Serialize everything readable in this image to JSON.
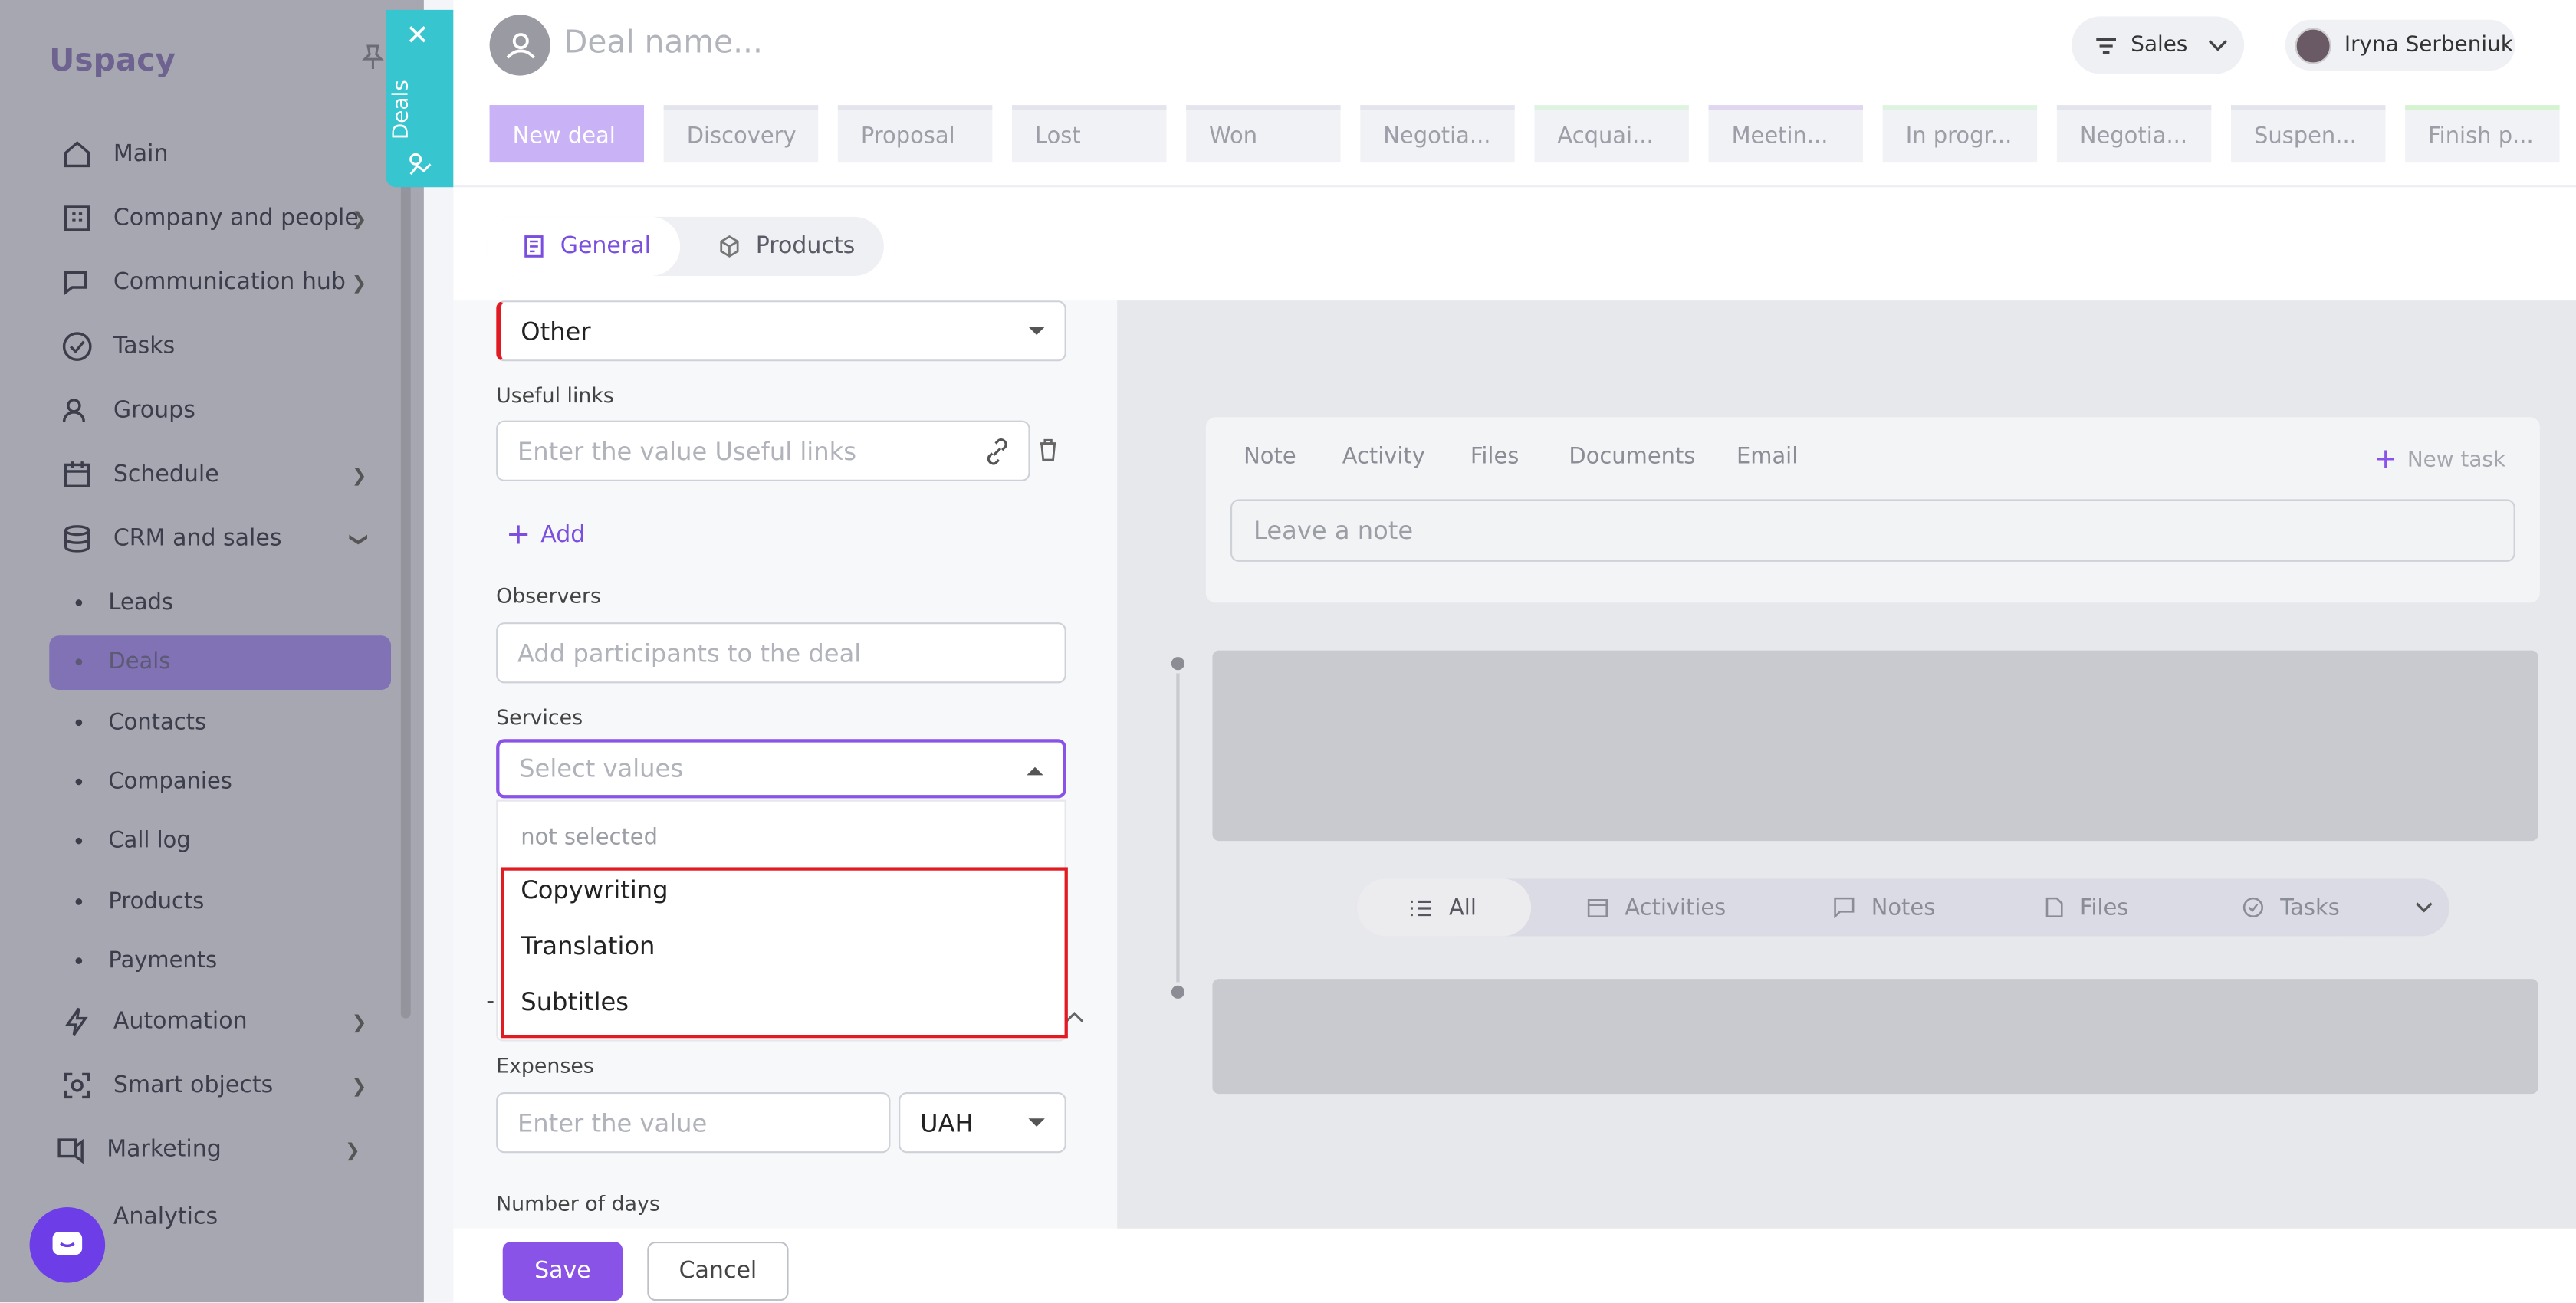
{
  "sidebar": {
    "logo": "Uspacy",
    "nav": [
      {
        "label": "Main",
        "icon": "home-icon"
      },
      {
        "label": "Company and people",
        "icon": "building-icon"
      },
      {
        "label": "Communication hub",
        "icon": "chat-edit-icon"
      },
      {
        "label": "Tasks",
        "icon": "check-circle-icon"
      },
      {
        "label": "Groups",
        "icon": "groups-icon"
      },
      {
        "label": "Schedule",
        "icon": "calendar-icon"
      },
      {
        "label": "CRM and sales",
        "icon": "database-icon"
      }
    ],
    "crm_sub": [
      "Leads",
      "Deals",
      "Contacts",
      "Companies",
      "Call log",
      "Products",
      "Payments"
    ],
    "nav_bottom": [
      {
        "label": "Automation",
        "icon": "lightning-icon"
      },
      {
        "label": "Smart objects",
        "icon": "smart-object-icon"
      },
      {
        "label": "Marketing",
        "icon": "marketing-icon"
      },
      {
        "label": "Analytics",
        "icon": "analytics-icon"
      }
    ]
  },
  "deals_tab": {
    "label": "Deals"
  },
  "header": {
    "deal_name_placeholder": "Deal name...",
    "pipeline": "Sales",
    "user_name": "Iryna Serbeniuk",
    "stages": [
      "New deal",
      "Discovery",
      "Proposal",
      "Lost",
      "Won",
      "Negotia...",
      "Acquai...",
      "Meetin...",
      "In progr...",
      "Negotia...",
      "Suspen...",
      "Finish p..."
    ],
    "stage_colors": [
      "#c9b2f6",
      "#e3e4ec",
      "#e3e4ec",
      "#e3e4ec",
      "#e3e4ec",
      "#e3e4ec",
      "#dff4e0",
      "#e0d6f0",
      "#dff4e0",
      "#e3e4ec",
      "#e3e4ec",
      "#d6f3d0"
    ]
  },
  "tabs": {
    "general": "General",
    "products": "Products"
  },
  "form": {
    "source_value": "Other",
    "useful_links_label": "Useful links",
    "useful_links_placeholder": "Enter the value Useful links",
    "add_label": "Add",
    "observers_label": "Observers",
    "observers_placeholder": "Add participants to the deal",
    "services_label": "Services",
    "services_placeholder": "Select values",
    "services_options": [
      "not selected",
      "Copywriting",
      "Translation",
      "Subtitles"
    ],
    "expenses_label": "Expenses",
    "expenses_placeholder": "Enter the value",
    "currency": "UAH",
    "days_label": "Number of days"
  },
  "activity": {
    "tabs": [
      "Note",
      "Activity",
      "Files",
      "Documents",
      "Email"
    ],
    "new_task": "New task",
    "note_placeholder": "Leave a note",
    "filters": [
      "All",
      "Activities",
      "Notes",
      "Files",
      "Tasks"
    ]
  },
  "footer": {
    "save": "Save",
    "cancel": "Cancel"
  },
  "colors": {
    "accent": "#8953e8",
    "highlight": "#e21a22",
    "deals_tab": "#37c6cf"
  }
}
